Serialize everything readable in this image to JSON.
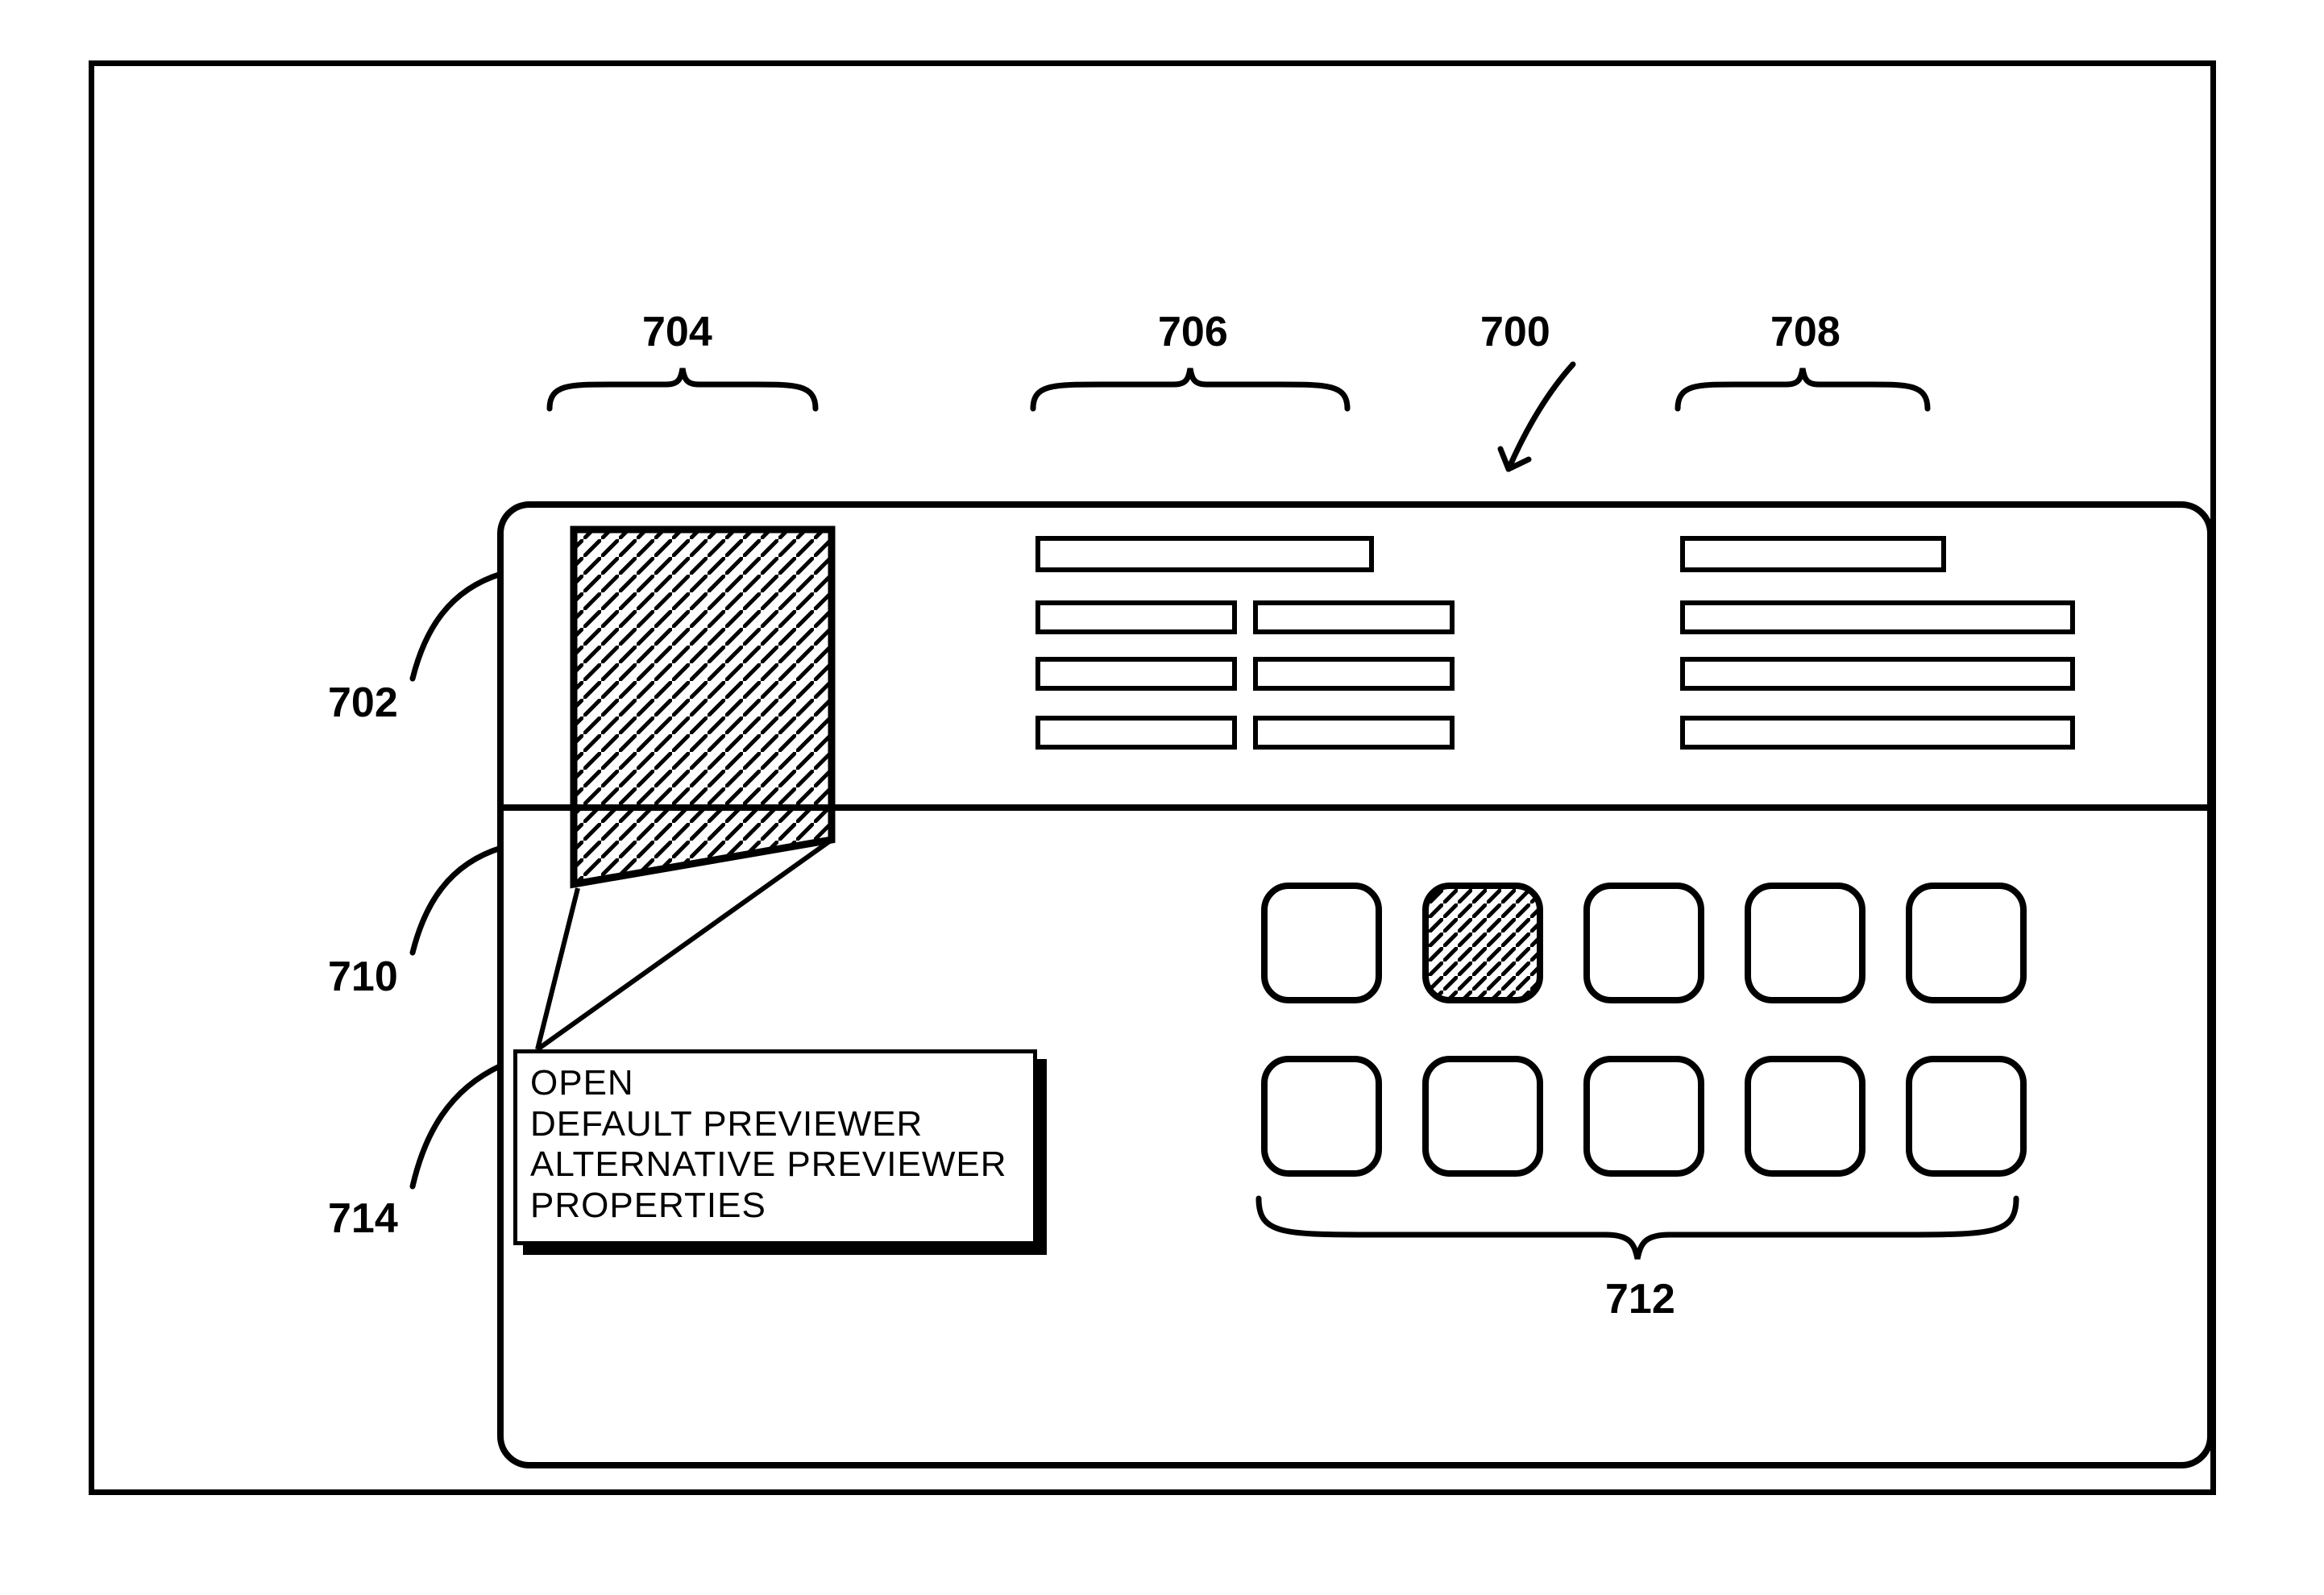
{
  "labels": {
    "l700": "700",
    "l702": "702",
    "l704": "704",
    "l706": "706",
    "l708": "708",
    "l710": "710",
    "l712": "712",
    "l714": "714"
  },
  "context_menu": {
    "items": [
      "OPEN",
      "DEFAULT PREVIEWER",
      "ALTERNATIVE PREVIEWER",
      "PROPERTIES"
    ]
  },
  "clusters": {
    "cluster706": {
      "row1": 1,
      "rows_23_4_pairs": 3
    },
    "cluster708": {
      "rows": 4
    }
  },
  "grid712": {
    "rows": 2,
    "cols": 5,
    "highlighted_index": 1
  }
}
